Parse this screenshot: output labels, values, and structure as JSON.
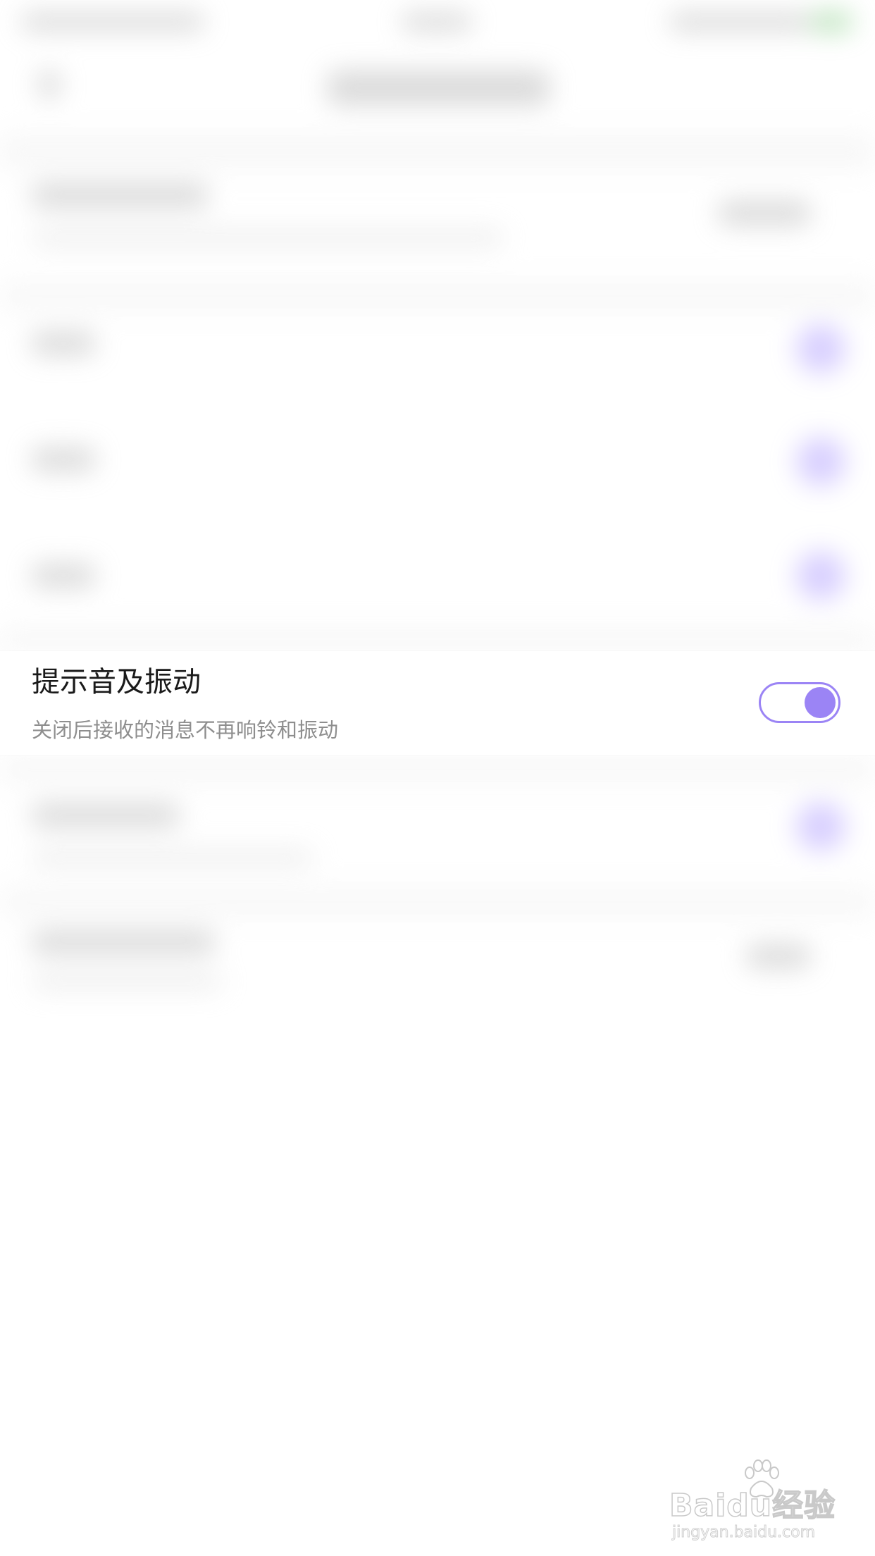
{
  "setting_row": {
    "title": "提示音及振动",
    "subtitle": "关闭后接收的消息不再响铃和振动",
    "toggle_on": true
  },
  "watermark": {
    "brand": "Baidu经验",
    "url": "jingyan.baidu.com"
  },
  "colors": {
    "accent": "#9b84f5",
    "title_text": "#1a1a1a",
    "subtitle_text": "#8e8e8e"
  },
  "icons": {
    "watermark": "baidu-paw-icon"
  }
}
